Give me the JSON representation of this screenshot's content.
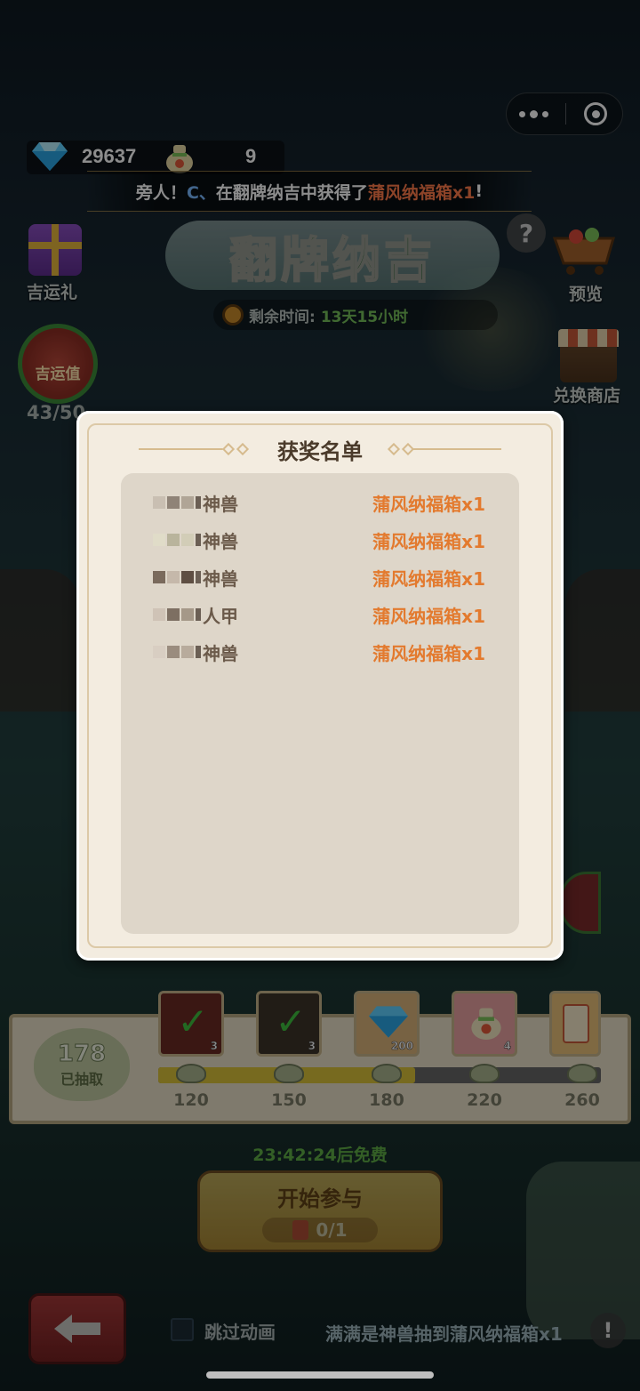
{
  "top": {
    "diamond_count": "29637",
    "bag_count": "9",
    "marquee": {
      "prefix": "旁人！",
      "player": "C、",
      "middle": "在翻牌纳吉中获得了",
      "prize": "蒲风纳福箱x1",
      "suffix": "!"
    }
  },
  "event": {
    "title": "翻牌纳吉",
    "help": "?",
    "timer_label": "剩余时间:",
    "timer_value": "13天15小时"
  },
  "side": {
    "left": [
      {
        "label": "吉运礼",
        "icon": "gift-icon"
      },
      {
        "label": "吉运值",
        "icon": "luck-bag-icon",
        "count": "43/50"
      }
    ],
    "right": [
      {
        "label": "预览",
        "icon": "cart-icon"
      },
      {
        "label": "兑换商店",
        "icon": "shop-icon"
      }
    ]
  },
  "modal": {
    "title": "获奖名单",
    "winners": [
      {
        "name": "神兽",
        "prize": "蒲风纳福箱x1"
      },
      {
        "name": "神兽",
        "prize": "蒲风纳福箱x1"
      },
      {
        "name": "神兽",
        "prize": "蒲风纳福箱x1"
      },
      {
        "name": "人甲",
        "prize": "蒲风纳福箱x1"
      },
      {
        "name": "神兽",
        "prize": "蒲风纳福箱x1"
      }
    ]
  },
  "progress": {
    "drawn_count": "178",
    "drawn_label": "已抽取",
    "fraction": 0.58,
    "milestones": [
      "120",
      "150",
      "180",
      "220",
      "260"
    ],
    "rewards": [
      {
        "icon": "claimed-check-icon",
        "qty": "3",
        "claimed": true
      },
      {
        "icon": "claimed-check-icon",
        "qty": "3",
        "claimed": true
      },
      {
        "icon": "diamond-icon",
        "qty": "200",
        "claimed": false
      },
      {
        "icon": "lucky-bag-icon",
        "qty": "4",
        "claimed": false
      },
      {
        "icon": "card-icon",
        "qty": "",
        "claimed": false
      }
    ]
  },
  "bottom": {
    "free_time": "23:42:24后免费",
    "start_label": "开始参与",
    "ticket_count": "0/1",
    "skip_label": "跳过动画",
    "ticker": "满满是神兽抽到蒲风纳福箱x1",
    "info": "!"
  },
  "colors": {
    "accent_orange": "#e37a2e",
    "accent_green": "#5fae45",
    "player_blue": "#79b8ff"
  }
}
